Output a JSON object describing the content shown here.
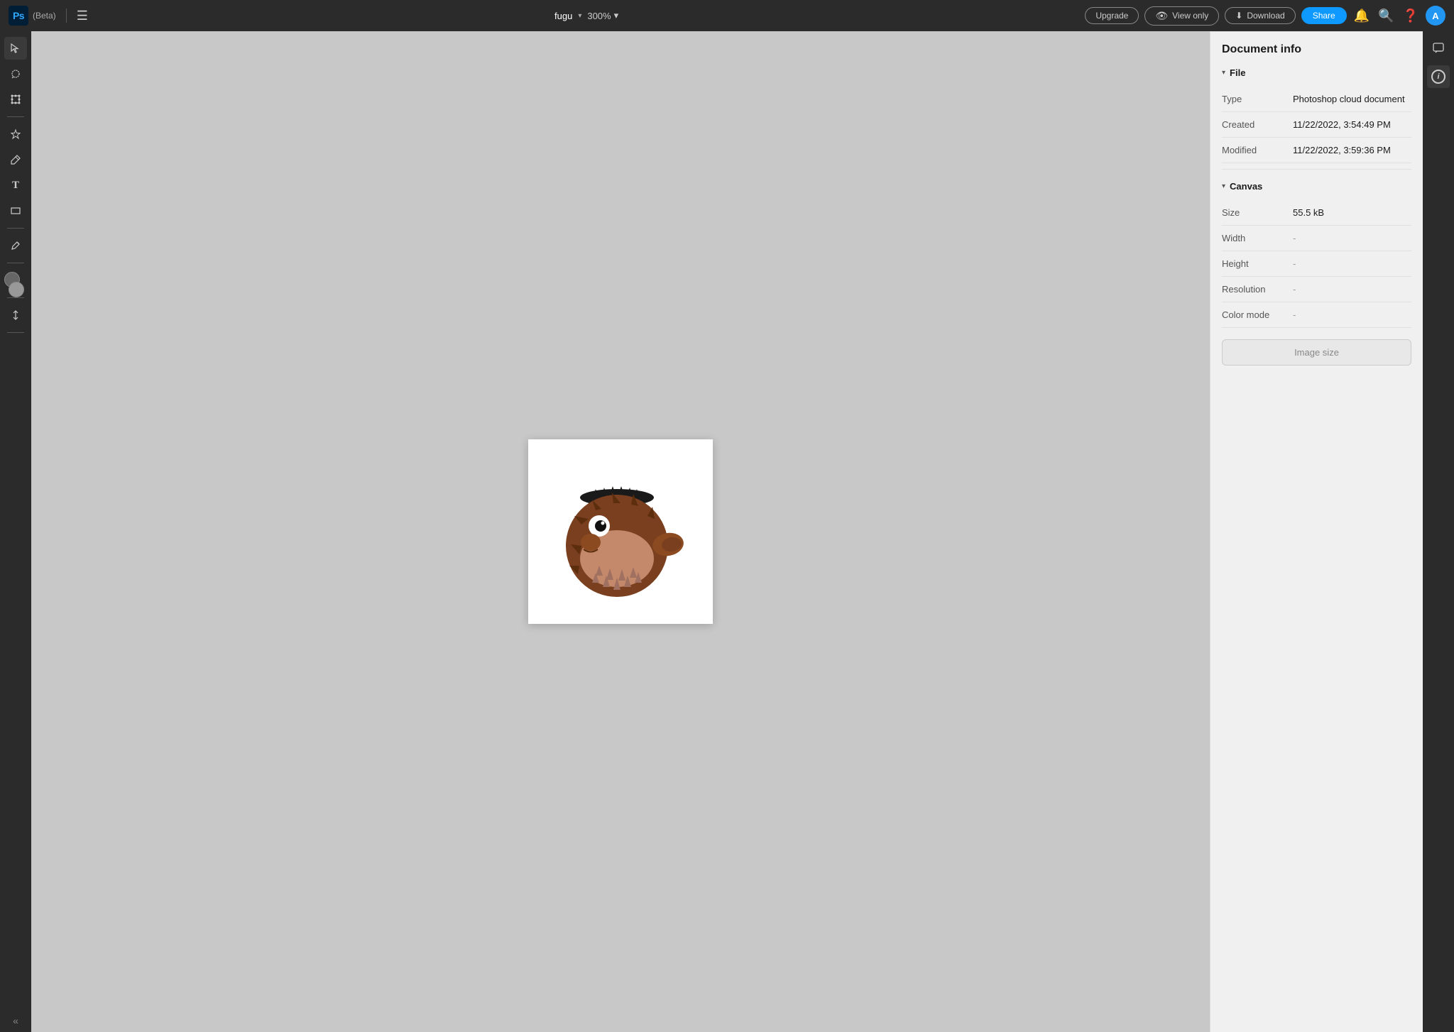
{
  "topbar": {
    "app_name": "Ps",
    "beta_label": "(Beta)",
    "file_name": "fugu",
    "zoom_level": "300%",
    "upgrade_label": "Upgrade",
    "view_only_label": "View only",
    "download_label": "Download",
    "share_label": "Share",
    "avatar_initials": "A"
  },
  "document_info": {
    "title": "Document info",
    "file_section": {
      "label": "File",
      "rows": [
        {
          "label": "Type",
          "value": "Photoshop cloud document",
          "dash": false
        },
        {
          "label": "Created",
          "value": "11/22/2022, 3:54:49 PM",
          "dash": false
        },
        {
          "label": "Modified",
          "value": "11/22/2022, 3:59:36 PM",
          "dash": false
        }
      ]
    },
    "canvas_section": {
      "label": "Canvas",
      "rows": [
        {
          "label": "Size",
          "value": "55.5 kB",
          "dash": false
        },
        {
          "label": "Width",
          "value": "-",
          "dash": true
        },
        {
          "label": "Height",
          "value": "-",
          "dash": true
        },
        {
          "label": "Resolution",
          "value": "-",
          "dash": true
        },
        {
          "label": "Color mode",
          "value": "-",
          "dash": true
        }
      ]
    },
    "image_size_button": "Image size"
  },
  "tools": {
    "left": [
      {
        "name": "select",
        "icon": "↖"
      },
      {
        "name": "lasso",
        "icon": "○"
      },
      {
        "name": "transform",
        "icon": "⊞"
      },
      {
        "name": "healing",
        "icon": "✦"
      },
      {
        "name": "brush",
        "icon": "/"
      },
      {
        "name": "text",
        "icon": "T"
      },
      {
        "name": "shape",
        "icon": "❑"
      },
      {
        "name": "eyedropper",
        "icon": "✏"
      }
    ]
  }
}
